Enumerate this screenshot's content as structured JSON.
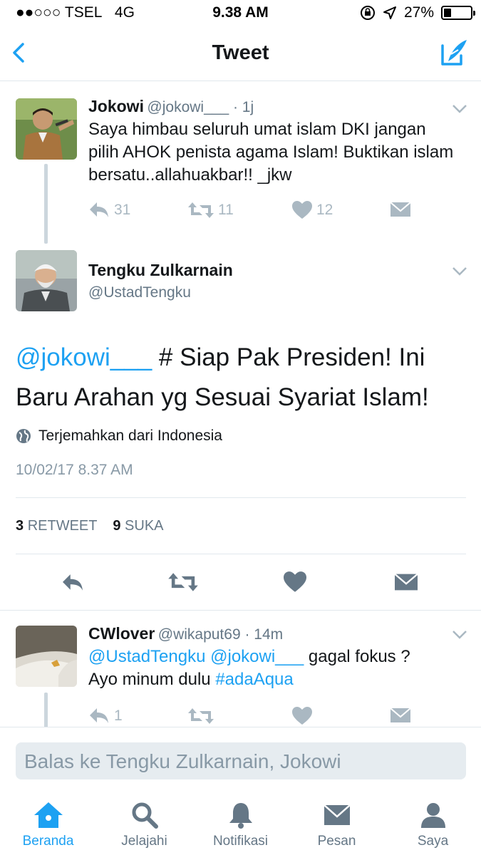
{
  "status_bar": {
    "carrier": "●●○○○ TSEL",
    "network": "4G",
    "time": "9.38 AM",
    "battery_percent": "27%",
    "battery_level": 0.27
  },
  "nav": {
    "title": "Tweet",
    "back_icon": "chevron-left-icon",
    "compose_icon": "compose-tweet-icon"
  },
  "parent_tweet": {
    "name": "Jokowi",
    "handle_time": "@jokowi___ · 1j",
    "text": "Saya himbau seluruh umat islam DKI jangan pilih AHOK penista agama Islam! Buktikan islam bersatu..allahuakbar!! _jkw",
    "reply_count": "31",
    "retweet_count": "11",
    "like_count": "12"
  },
  "main_tweet": {
    "name": "Tengku Zulkarnain",
    "handle": "@UstadTengku",
    "mention": "@jokowi___",
    "text": " # Siap Pak Presiden! Ini Baru Arahan yg Sesuai Syariat Islam!",
    "translate": "Terjemahkan dari Indonesia",
    "timestamp": "10/02/17 8.37 AM",
    "retweets_num": "3",
    "retweets_label": "RETWEET",
    "likes_num": "9",
    "likes_label": "SUKA"
  },
  "reply_tweet": {
    "name": "CWlover",
    "handle_time": "@wikaput69 · 14m",
    "mention1": "@UstadTengku",
    "mention2": "@jokowi___",
    "text1": " gagal fokus ?",
    "text2": "Ayo minum dulu ",
    "hashtag": "#adaAqua",
    "reply_count": "1"
  },
  "reply_box": {
    "placeholder": "Balas ke Tengku Zulkarnain, Jokowi"
  },
  "tabs": [
    {
      "label": "Beranda",
      "icon": "home-icon"
    },
    {
      "label": "Jelajahi",
      "icon": "search-icon"
    },
    {
      "label": "Notifikasi",
      "icon": "bell-icon"
    },
    {
      "label": "Pesan",
      "icon": "envelope-icon"
    },
    {
      "label": "Saya",
      "icon": "profile-icon"
    }
  ],
  "colors": {
    "accent": "#1da1f2",
    "muted": "#aab8c2",
    "divider": "#e1e8ed"
  }
}
